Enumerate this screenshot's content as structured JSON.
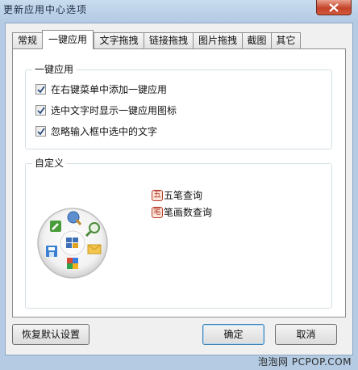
{
  "window": {
    "title": "更新应用中心选项"
  },
  "tabs": [
    {
      "label": "常规",
      "active": false
    },
    {
      "label": "一键应用",
      "active": true
    },
    {
      "label": "文字拖拽",
      "active": false
    },
    {
      "label": "链接拖拽",
      "active": false
    },
    {
      "label": "图片拖拽",
      "active": false
    },
    {
      "label": "截图",
      "active": false
    },
    {
      "label": "其它",
      "active": false
    }
  ],
  "group_onekey": {
    "title": "一键应用",
    "options": [
      {
        "label": "在右键菜单中添加一键应用",
        "checked": true
      },
      {
        "label": "选中文字时显示一键应用图标",
        "checked": true
      },
      {
        "label": "忽略输入框中选中的文字",
        "checked": true
      }
    ]
  },
  "group_custom": {
    "title": "自定义",
    "entries": [
      {
        "icon_char": "五",
        "label": "五笔查询"
      },
      {
        "icon_char": "笔",
        "label": "笔画数查询"
      }
    ],
    "wheel_icons": [
      "pencil-icon",
      "search-globe-icon",
      "magnifier-icon",
      "mail-icon",
      "google-icon",
      "save-disk-icon",
      "grid-center-icon"
    ]
  },
  "buttons": {
    "restore": "恢复默认设置",
    "ok": "确定",
    "cancel": "取消"
  },
  "watermark": "泡泡网 PCPOP.COM",
  "colors": {
    "title_bar": "#b9cfe5",
    "close_button": "#c4432a",
    "tab_border": "#8e8f8f"
  }
}
